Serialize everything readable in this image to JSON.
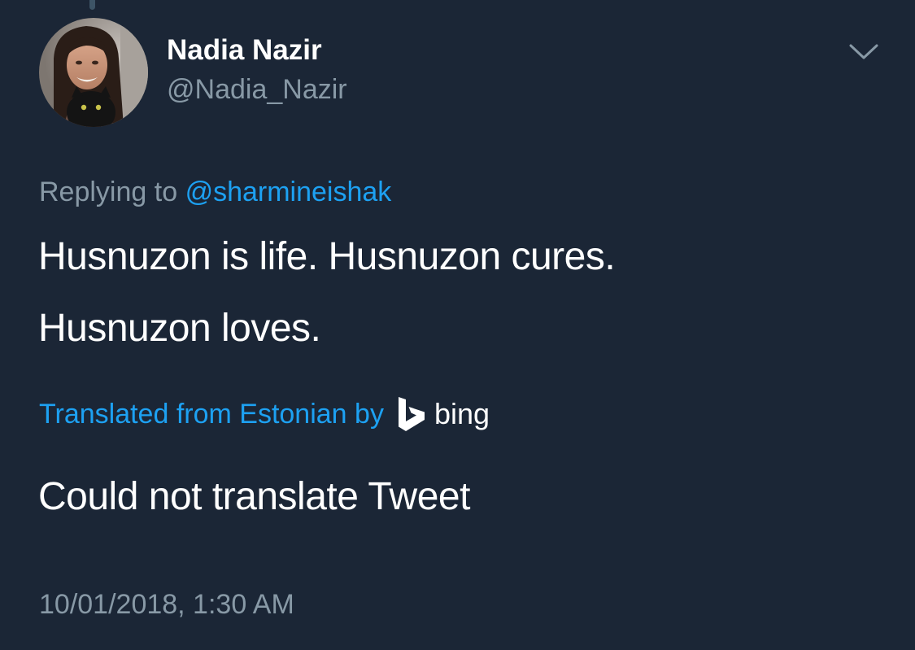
{
  "tweet": {
    "author": {
      "display_name": "Nadia Nazir",
      "handle": "@Nadia_Nazir",
      "avatar_icon": "profile-photo-woman-with-black-cat"
    },
    "menu_icon": "chevron-down-icon",
    "replying_prefix": "Replying to",
    "replying_to": "@sharmineishak",
    "text_lines": [
      "Husnuzon is life. Husnuzon cures.",
      "Husnuzon loves."
    ],
    "timestamp": "10/01/2018, 1:30 AM"
  },
  "translation": {
    "label": "Translated from Estonian by",
    "provider": "bing",
    "provider_icon": "bing-logo-icon",
    "result": "Could not translate Tweet"
  },
  "colors": {
    "background": "#1b2636",
    "primary_text": "#ffffff",
    "secondary_text": "#8899a6",
    "link": "#1da1f2"
  }
}
